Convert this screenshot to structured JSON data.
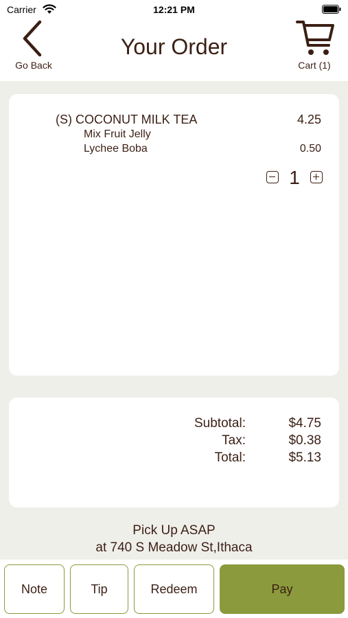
{
  "status_bar": {
    "carrier": "Carrier",
    "time": "12:21 PM"
  },
  "header": {
    "back_label": "Go Back",
    "title": "Your Order",
    "cart_label": "Cart (1)"
  },
  "order": {
    "item_name": "(S) COCONUT MILK TEA",
    "item_price": "4.25",
    "modifiers": [
      {
        "name": "Mix Fruit Jelly",
        "price": ""
      },
      {
        "name": "Lychee Boba",
        "price": "0.50"
      }
    ],
    "quantity": "1"
  },
  "totals": {
    "subtotal_label": "Subtotal:",
    "subtotal_value": "$4.75",
    "tax_label": "Tax:",
    "tax_value": "$0.38",
    "total_label": "Total:",
    "total_value": "$5.13"
  },
  "pickup": {
    "line1": "Pick Up ASAP",
    "line2": "at 740 S  Meadow St,Ithaca"
  },
  "actions": {
    "note": "Note",
    "tip": "Tip",
    "redeem": "Redeem",
    "pay": "Pay"
  },
  "colors": {
    "brand_text": "#3b1f14",
    "accent_olive": "#8a9a3c",
    "background": "#efefea"
  }
}
